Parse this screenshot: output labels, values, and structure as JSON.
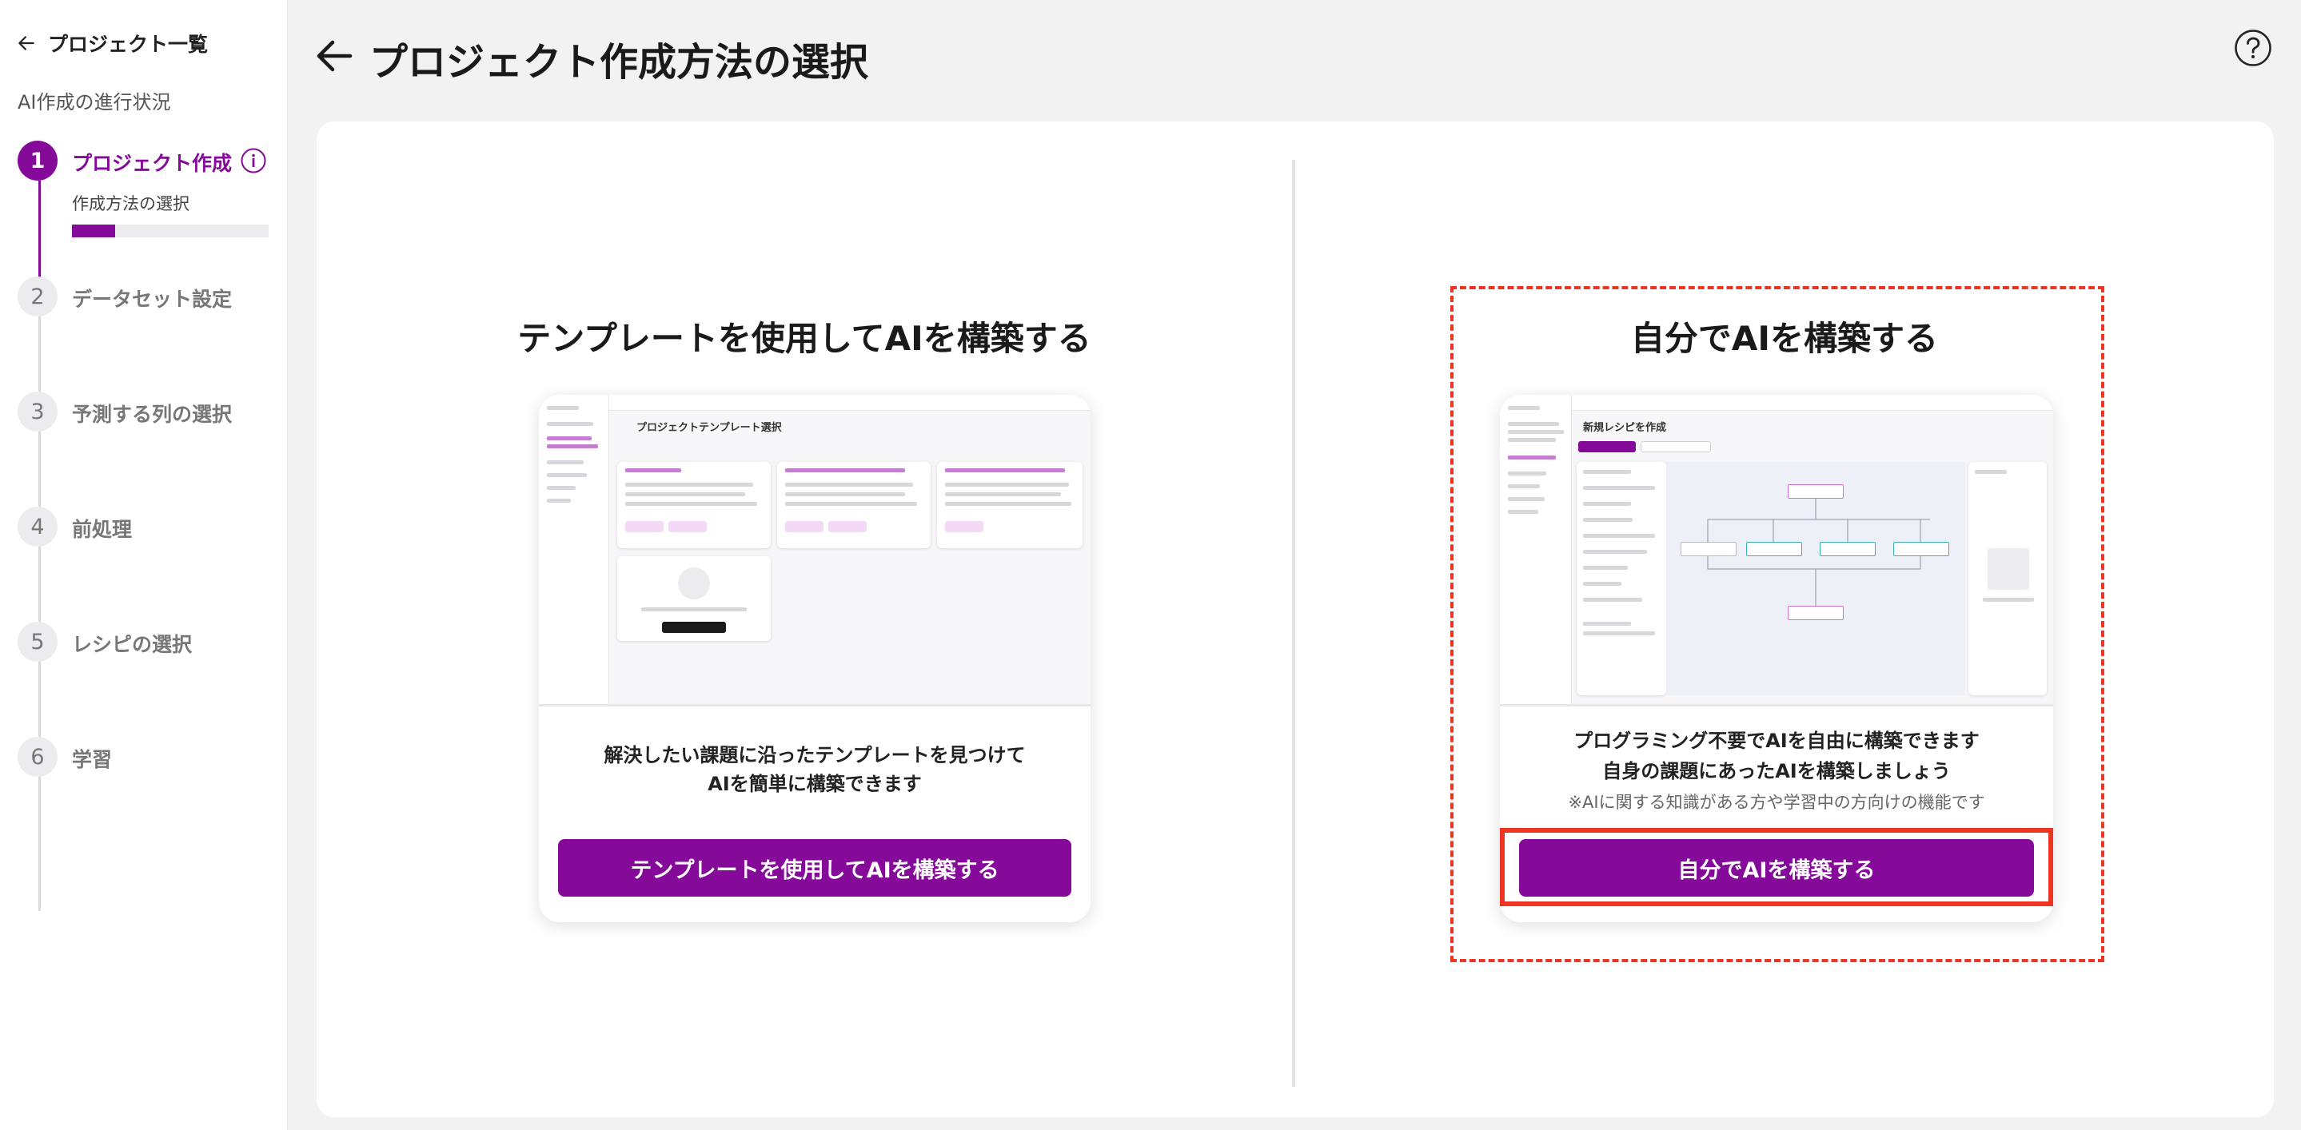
{
  "sidebar": {
    "back_label": "プロジェクト一覧",
    "progress_heading": "AI作成の進行状況",
    "steps": [
      {
        "num": "1",
        "label": "プロジェクト作成",
        "sub_label": "作成方法の選択",
        "progress": 0.22
      },
      {
        "num": "2",
        "label": "データセット設定"
      },
      {
        "num": "3",
        "label": "予測する列の選択"
      },
      {
        "num": "4",
        "label": "前処理"
      },
      {
        "num": "5",
        "label": "レシピの選択"
      },
      {
        "num": "6",
        "label": "学習"
      }
    ]
  },
  "header": {
    "title": "プロジェクト作成方法の選択"
  },
  "options": {
    "template": {
      "title": "テンプレートを使用してAIを構築する",
      "desc_line1": "解決したい課題に沿ったテンプレートを見つけて",
      "desc_line2": "AIを簡単に構築できます",
      "button": "テンプレートを使用してAIを構築する",
      "preview_heading": "プロジェクトテンプレート選択"
    },
    "custom": {
      "title": "自分でAIを構築する",
      "desc_line1": "プログラミング不要でAIを自由に構築できます",
      "desc_line2": "自身の課題にあったAIを構築しましょう",
      "note": "※AIに関する知識がある方や学習中の方向けの機能です",
      "button": "自分でAIを構築する",
      "preview_heading": "新規レシピを作成"
    }
  },
  "colors": {
    "accent": "#850a99",
    "highlight": "#ee3524"
  }
}
